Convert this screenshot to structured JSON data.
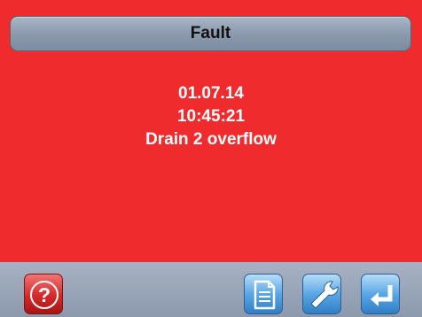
{
  "header": {
    "title": "Fault"
  },
  "message": {
    "date": "01.07.14",
    "time": "10:45:21",
    "text": "Drain 2 overflow"
  },
  "toolbar": {
    "buttons": [
      {
        "icon": "help-icon",
        "glyph": "?"
      },
      {
        "icon": "document-icon"
      },
      {
        "icon": "wrench-icon"
      },
      {
        "icon": "enter-icon"
      }
    ]
  },
  "colors": {
    "fault_background": "#ef2b2d",
    "toolbar": "#9aa6b8",
    "help_button": "#d32a2a",
    "action_buttons": "#4f9be0"
  }
}
